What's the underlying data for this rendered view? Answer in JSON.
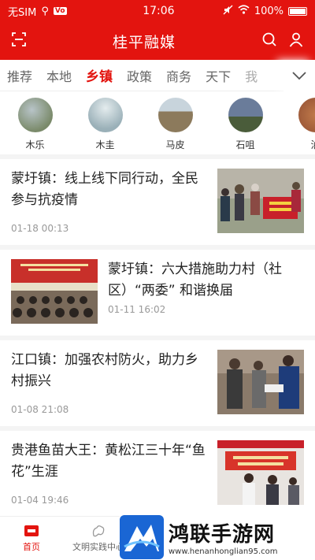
{
  "status_bar": {
    "carrier": "无SIM",
    "hd_badge": "Vo",
    "time": "17:06",
    "battery": "100%"
  },
  "header": {
    "title": "桂平融媒",
    "icons": [
      "scan-icon",
      "search-icon",
      "user-icon"
    ]
  },
  "tabs": [
    {
      "label": "推荐",
      "active": false
    },
    {
      "label": "本地",
      "active": false
    },
    {
      "label": "乡镇",
      "active": true
    },
    {
      "label": "政策",
      "active": false
    },
    {
      "label": "商务",
      "active": false
    },
    {
      "label": "天下",
      "active": false
    },
    {
      "label": "我",
      "active": false
    }
  ],
  "towns": [
    {
      "name": "木乐",
      "color": "#7a8a6a"
    },
    {
      "name": "木圭",
      "color": "#9ab0b8"
    },
    {
      "name": "马皮",
      "color": "#8c7a5c"
    },
    {
      "name": "石咀",
      "color": "#6a7c9a"
    },
    {
      "name": "油",
      "color": "#a05c3a"
    }
  ],
  "news": [
    {
      "title": "蒙圩镇：线上线下同行动，全民参与抗疫情",
      "time": "01-18 00:13",
      "layout": "right"
    },
    {
      "title": "蒙圩镇：六大措施助力村（社区）“两委” 和谐换届",
      "time": "01-11 16:02",
      "layout": "left"
    },
    {
      "title": "江口镇：加强农村防火，助力乡村振兴",
      "time": "01-08 21:08",
      "layout": "right"
    },
    {
      "title": "贵港鱼苗大王：黄松江三十年“鱼花”生涯",
      "time": "01-04 19:46",
      "layout": "right"
    }
  ],
  "bottom_nav": [
    {
      "label": "首页",
      "active": true
    },
    {
      "label": "文明实践中心",
      "active": false
    }
  ],
  "watermark": {
    "title": "鸿联手游网",
    "url": "www.henanhonglian95.com"
  },
  "colors": {
    "brand": "#e3140f"
  }
}
